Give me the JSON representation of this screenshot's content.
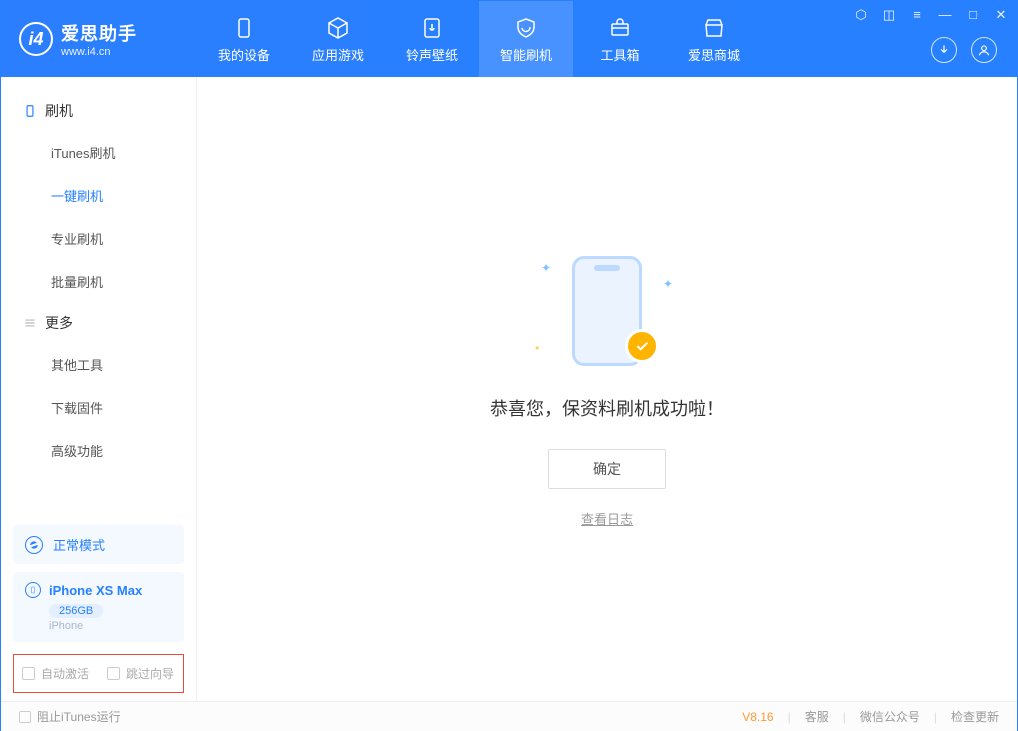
{
  "app": {
    "title": "爱思助手",
    "subtitle": "www.i4.cn"
  },
  "tabs": [
    {
      "label": "我的设备"
    },
    {
      "label": "应用游戏"
    },
    {
      "label": "铃声壁纸"
    },
    {
      "label": "智能刷机"
    },
    {
      "label": "工具箱"
    },
    {
      "label": "爱思商城"
    }
  ],
  "sidebar": {
    "group1": "刷机",
    "items": [
      "iTunes刷机",
      "一键刷机",
      "专业刷机",
      "批量刷机"
    ],
    "group2": "更多",
    "items2": [
      "其他工具",
      "下载固件",
      "高级功能"
    ]
  },
  "mode_card": "正常模式",
  "device": {
    "name": "iPhone XS Max",
    "storage": "256GB",
    "type": "iPhone"
  },
  "options": {
    "auto_activate": "自动激活",
    "skip_guide": "跳过向导"
  },
  "main": {
    "success": "恭喜您，保资料刷机成功啦！",
    "confirm": "确定",
    "log": "查看日志"
  },
  "footer": {
    "block_itunes": "阻止iTunes运行",
    "version": "V8.16",
    "links": [
      "客服",
      "微信公众号",
      "检查更新"
    ]
  }
}
